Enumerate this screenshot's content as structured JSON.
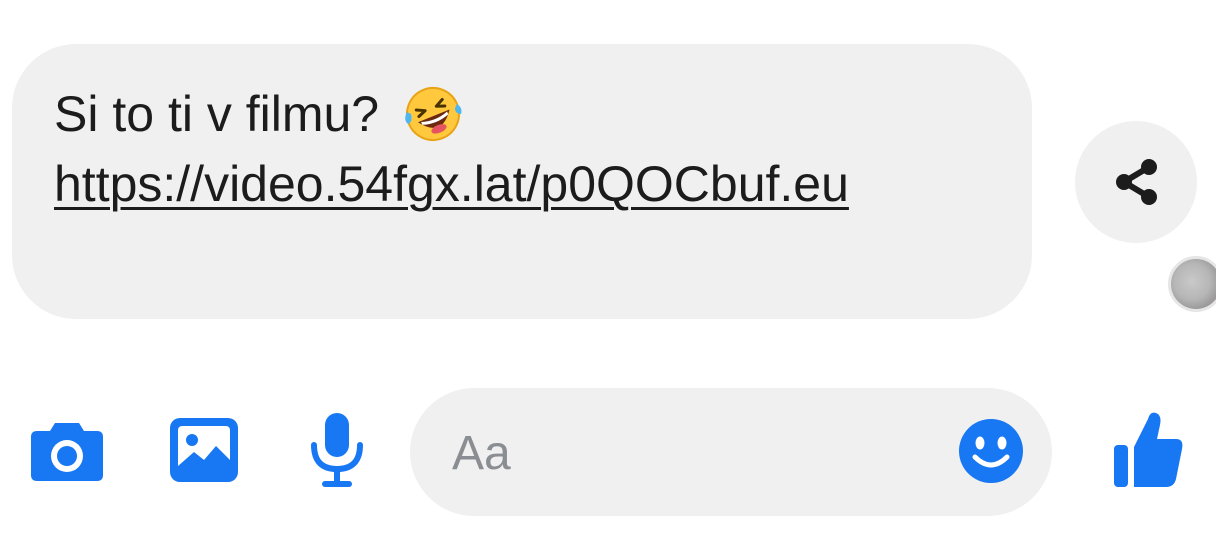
{
  "message": {
    "text": "Si to ti v filmu?",
    "emoji_name": "rolling-on-the-floor-laughing",
    "link": "https://video.54fgx.lat/p0QOCbuf.eu"
  },
  "composer": {
    "placeholder": "Aa"
  },
  "icons": {
    "camera": "camera-icon",
    "gallery": "image-icon",
    "mic": "microphone-icon",
    "emoji": "smiley-icon",
    "like": "thumbs-up-icon",
    "share": "share-icon"
  },
  "colors": {
    "accent": "#1877f2",
    "bubble": "#f0f0f0",
    "text": "#1c1c1c",
    "placeholder": "#8a8d91"
  }
}
